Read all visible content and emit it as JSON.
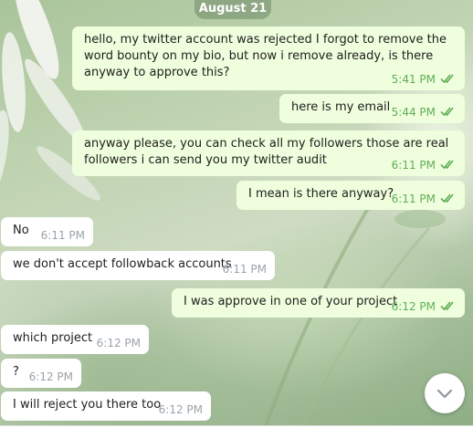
{
  "date_label": "August 21",
  "messages": [
    {
      "direction": "out",
      "text": "hello, my twitter account was rejected I forgot to remove the word bounty on my bio, but now i remove already, is there anyway to approve this?",
      "time": "5:41 PM",
      "read": true
    },
    {
      "direction": "out",
      "text": "here is my email",
      "time": "5:44 PM",
      "read": true
    },
    {
      "direction": "out",
      "text": "anyway please, you can check all my followers those are real followers i can send you my twitter audit",
      "time": "6:11 PM",
      "read": true
    },
    {
      "direction": "out",
      "text": "I mean is there anyway?",
      "time": "6:11 PM",
      "read": true
    },
    {
      "direction": "in",
      "text": "No",
      "time": "6:11 PM"
    },
    {
      "direction": "in",
      "text": "we don't accept followback accounts",
      "time": "6:11 PM"
    },
    {
      "direction": "out",
      "text": "I was approve in one of your project",
      "time": "6:12 PM",
      "read": true
    },
    {
      "direction": "in",
      "text": "which project",
      "time": "6:12 PM"
    },
    {
      "direction": "in",
      "text": "?",
      "time": "6:12 PM"
    },
    {
      "direction": "in",
      "text": "I will reject you there too",
      "time": "6:12 PM"
    }
  ],
  "scroll_button": {
    "icon": "chevron-down-icon"
  },
  "colors": {
    "outgoing_bubble": "#effedd",
    "incoming_bubble": "#ffffff",
    "outgoing_time": "#5fad56",
    "incoming_time": "#9aa3ab",
    "date_pill": "#829b78"
  }
}
